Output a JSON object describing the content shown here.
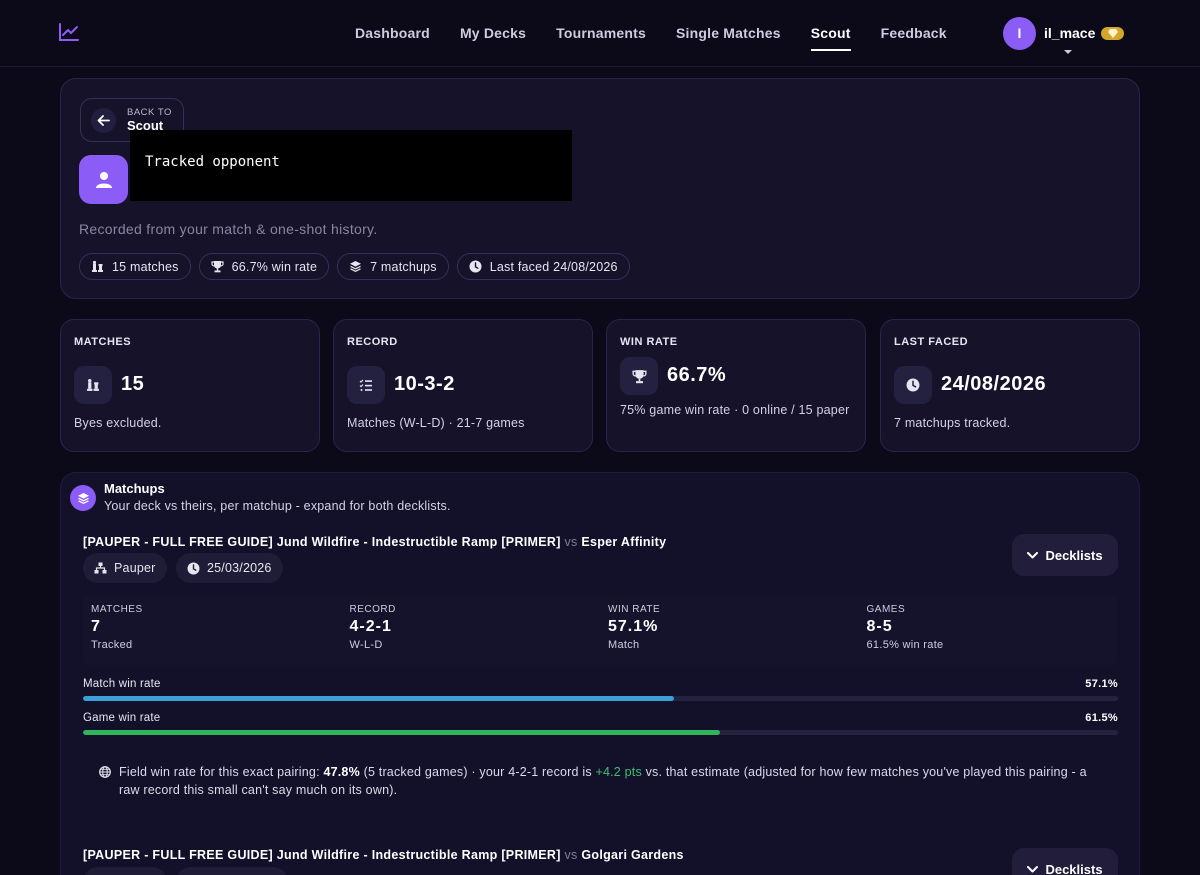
{
  "nav": {
    "links": [
      "Dashboard",
      "My Decks",
      "Tournaments",
      "Single Matches",
      "Scout",
      "Feedback"
    ],
    "active": "Scout",
    "user": {
      "initial": "I",
      "name": "il_mace"
    }
  },
  "header": {
    "back_small": "BACK TO",
    "back_main": "Scout",
    "title": "Tracked opponent",
    "subtitle": "Recorded from your match & one-shot history.",
    "pills": [
      "15 matches",
      "66.7% win rate",
      "7 matchups",
      "Last faced 24/08/2026"
    ]
  },
  "stats": {
    "matches": {
      "label": "MATCHES",
      "value": "15",
      "note": "Byes excluded."
    },
    "record": {
      "label": "RECORD",
      "value": "10-3-2",
      "note": "Matches (W-L-D) · 21-7 games"
    },
    "win_rate": {
      "label": "WIN RATE",
      "value": "66.7%",
      "note": "75% game win rate · 0 online / 15 paper"
    },
    "last_faced": {
      "label": "LAST FACED",
      "value": "24/08/2026",
      "note": "7 matchups tracked."
    }
  },
  "matchups": {
    "title": "Matchups",
    "subtitle": "Your deck vs theirs, per matchup - expand for both decklists.",
    "items": [
      {
        "deck": "[PAUPER - FULL FREE GUIDE] Jund Wildfire - Indestructible Ramp [PRIMER]",
        "vs": "vs",
        "opponent": "Esper Affinity",
        "format": "Pauper",
        "date": "25/03/2026",
        "decklists_label": "Decklists",
        "stats": [
          {
            "label": "MATCHES",
            "value": "7",
            "note": "Tracked"
          },
          {
            "label": "RECORD",
            "value": "4-2-1",
            "note": "W-L-D"
          },
          {
            "label": "WIN RATE",
            "value": "57.1%",
            "note": "Match"
          },
          {
            "label": "GAMES",
            "value": "8-5",
            "note": "61.5% win rate"
          }
        ],
        "bars": [
          {
            "label": "Match win rate",
            "pct_text": "57.1%",
            "value": 57.1,
            "color": "#3b9fd8"
          },
          {
            "label": "Game win rate",
            "pct_text": "61.5%",
            "value": 61.5,
            "color": "#2fb45a"
          }
        ],
        "field_note": {
          "pre": "Field win rate for this exact pairing:",
          "rate": "47.8%",
          "mid": "(5 tracked games) · your 4-2-1 record is",
          "delta": "+4.2 pts",
          "post": "vs. that estimate (adjusted for how few matches you've played this pairing - a raw record this small can't say much on its own)."
        }
      },
      {
        "deck": "[PAUPER - FULL FREE GUIDE] Jund Wildfire - Indestructible Ramp [PRIMER]",
        "vs": "vs",
        "opponent": "Golgari Gardens",
        "decklists_label": "Decklists"
      }
    ]
  },
  "colors": {
    "accent": "#8b5cf6",
    "background": "#0c0a19",
    "card": "#15122a",
    "positive": "#3fbf6e",
    "gem": "#d4a72c"
  },
  "icons": [
    "chart-line-icon",
    "gem-icon",
    "arrow-left-icon",
    "user-icon",
    "chess-pieces-icon",
    "trophy-icon",
    "layers-icon",
    "clock-icon",
    "list-check-icon",
    "sitemap-icon",
    "chevron-down-icon",
    "globe-icon"
  ]
}
